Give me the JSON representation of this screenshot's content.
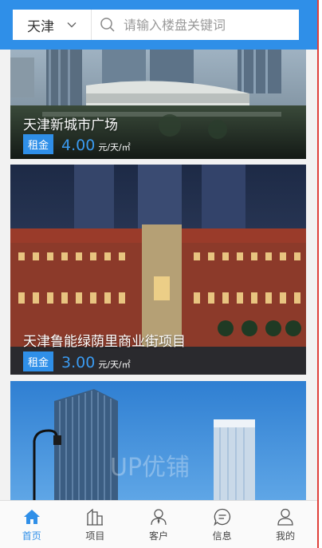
{
  "header": {
    "city": "天津",
    "search_placeholder": "请输入楼盘关键词"
  },
  "listings": [
    {
      "title": "天津新城市广场",
      "badge": "租金",
      "price": "4.00",
      "unit": "元/天/㎡"
    },
    {
      "title": "天津鲁能绿荫里商业街项目",
      "badge": "租金",
      "price": "3.00",
      "unit": "元/天/㎡"
    },
    {
      "title": "",
      "badge": "",
      "price": "",
      "unit": ""
    }
  ],
  "bottom_nav": {
    "items": [
      {
        "label": "首页",
        "icon": "home-icon",
        "active": true
      },
      {
        "label": "项目",
        "icon": "buildings-icon",
        "active": false
      },
      {
        "label": "客户",
        "icon": "person-tie-icon",
        "active": false
      },
      {
        "label": "信息",
        "icon": "message-icon",
        "active": false
      },
      {
        "label": "我的",
        "icon": "user-icon",
        "active": false
      }
    ]
  },
  "colors": {
    "accent": "#2f8fe8",
    "price": "#3a9af0"
  }
}
